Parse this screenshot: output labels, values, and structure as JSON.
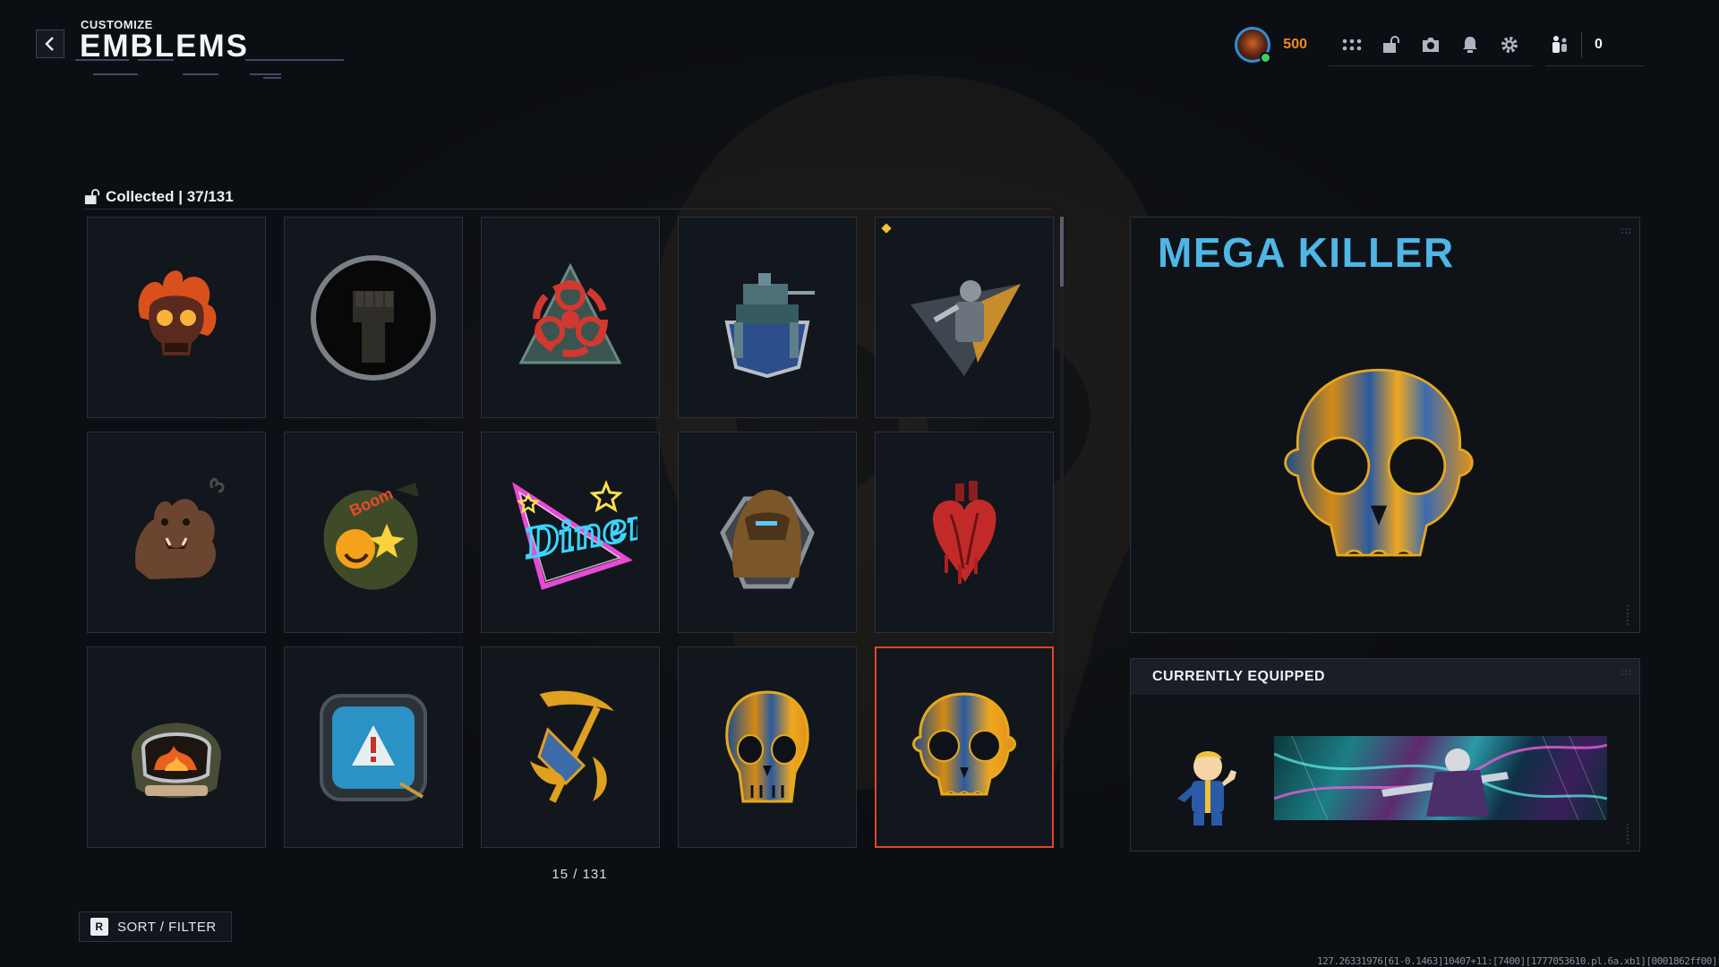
{
  "header": {
    "section": "CUSTOMIZE",
    "title": "EMBLEMS",
    "back_icon": "chevron-left-icon"
  },
  "topbar": {
    "currency_value": "500",
    "currency_color": "#f28a23",
    "icons": [
      "grid-dots-icon",
      "unlock-icon",
      "camera-icon",
      "bell-icon",
      "gear-icon"
    ],
    "party_icon": "party-icon",
    "party_count": "0"
  },
  "collection": {
    "label": "Collected | 37/131",
    "page_counter": "15 / 131",
    "selected_index": 14,
    "items": [
      {
        "name": "flaming-skull-emblem"
      },
      {
        "name": "fist-emblem"
      },
      {
        "name": "biohazard-emblem"
      },
      {
        "name": "mech-walker-emblem"
      },
      {
        "name": "operator-triangle-emblem",
        "is_new": true
      },
      {
        "name": "bear-emblem"
      },
      {
        "name": "bomb-emblem"
      },
      {
        "name": "diner-neon-emblem",
        "text": "Diner"
      },
      {
        "name": "yeti-emblem"
      },
      {
        "name": "anatomical-heart-emblem"
      },
      {
        "name": "bomb-suit-helmet-emblem"
      },
      {
        "name": "warning-monitor-emblem"
      },
      {
        "name": "reaper-scythe-emblem"
      },
      {
        "name": "skull-emblem"
      },
      {
        "name": "mega-killer-skull-emblem"
      }
    ]
  },
  "sort_filter": {
    "key": "R",
    "label": "SORT / FILTER"
  },
  "preview": {
    "title": "MEGA KILLER",
    "title_color": "#4fb6e6"
  },
  "equipped": {
    "heading": "CURRENTLY EQUIPPED",
    "emblem": "vault-boy-emblem",
    "calling_card": "neon-operator-calling-card"
  },
  "debug_text": "127.26331976[61-0.1463]10407+11:[7400][1777053610.pl.6a.xb1][0001862ff00]",
  "colors": {
    "selected_border": "#e0452b",
    "new_marker": "#f2c234"
  }
}
